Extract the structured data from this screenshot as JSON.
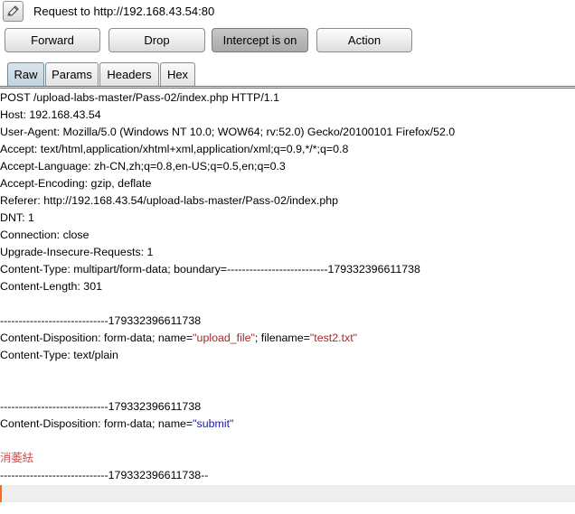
{
  "title": "Request to http://192.168.43.54:80",
  "buttons": {
    "forward": "Forward",
    "drop": "Drop",
    "intercept": "Intercept is on",
    "action": "Action"
  },
  "tabs": [
    "Raw",
    "Params",
    "Headers",
    "Hex"
  ],
  "request": {
    "request_line": "POST /upload-labs-master/Pass-02/index.php HTTP/1.1",
    "host": "Host: 192.168.43.54",
    "user_agent": "User-Agent: Mozilla/5.0 (Windows NT 10.0; WOW64; rv:52.0) Gecko/20100101 Firefox/52.0",
    "accept": "Accept: text/html,application/xhtml+xml,application/xml;q=0.9,*/*;q=0.8",
    "accept_language": "Accept-Language: zh-CN,zh;q=0.8,en-US;q=0.5,en;q=0.3",
    "accept_encoding": "Accept-Encoding: gzip, deflate",
    "referer": "Referer: http://192.168.43.54/upload-labs-master/Pass-02/index.php",
    "dnt": "DNT: 1",
    "connection": "Connection: close",
    "upgrade": "Upgrade-Insecure-Requests: 1",
    "content_type": "Content-Type: multipart/form-data; boundary=---------------------------179332396611738",
    "content_length": "Content-Length: 301",
    "boundary1": "-----------------------------179332396611738",
    "disp1_prefix": "Content-Disposition: form-data; name=",
    "disp1_name": "\"upload_file\"",
    "disp1_mid": "; filename=",
    "disp1_filename": "\"test2.txt\"",
    "part_content_type": "Content-Type: text/plain",
    "boundary2": "-----------------------------179332396611738",
    "disp2_prefix": "Content-Disposition: form-data; name=",
    "disp2_name": "\"submit\"",
    "garbled_value": "消萎紶",
    "boundary_end": "-----------------------------179332396611738--"
  },
  "colors": {
    "caret": "#ff6a1a",
    "active_tab": "#c2d3de",
    "string_red": "#a52a2a",
    "string_blue": "#1a1aa6"
  }
}
